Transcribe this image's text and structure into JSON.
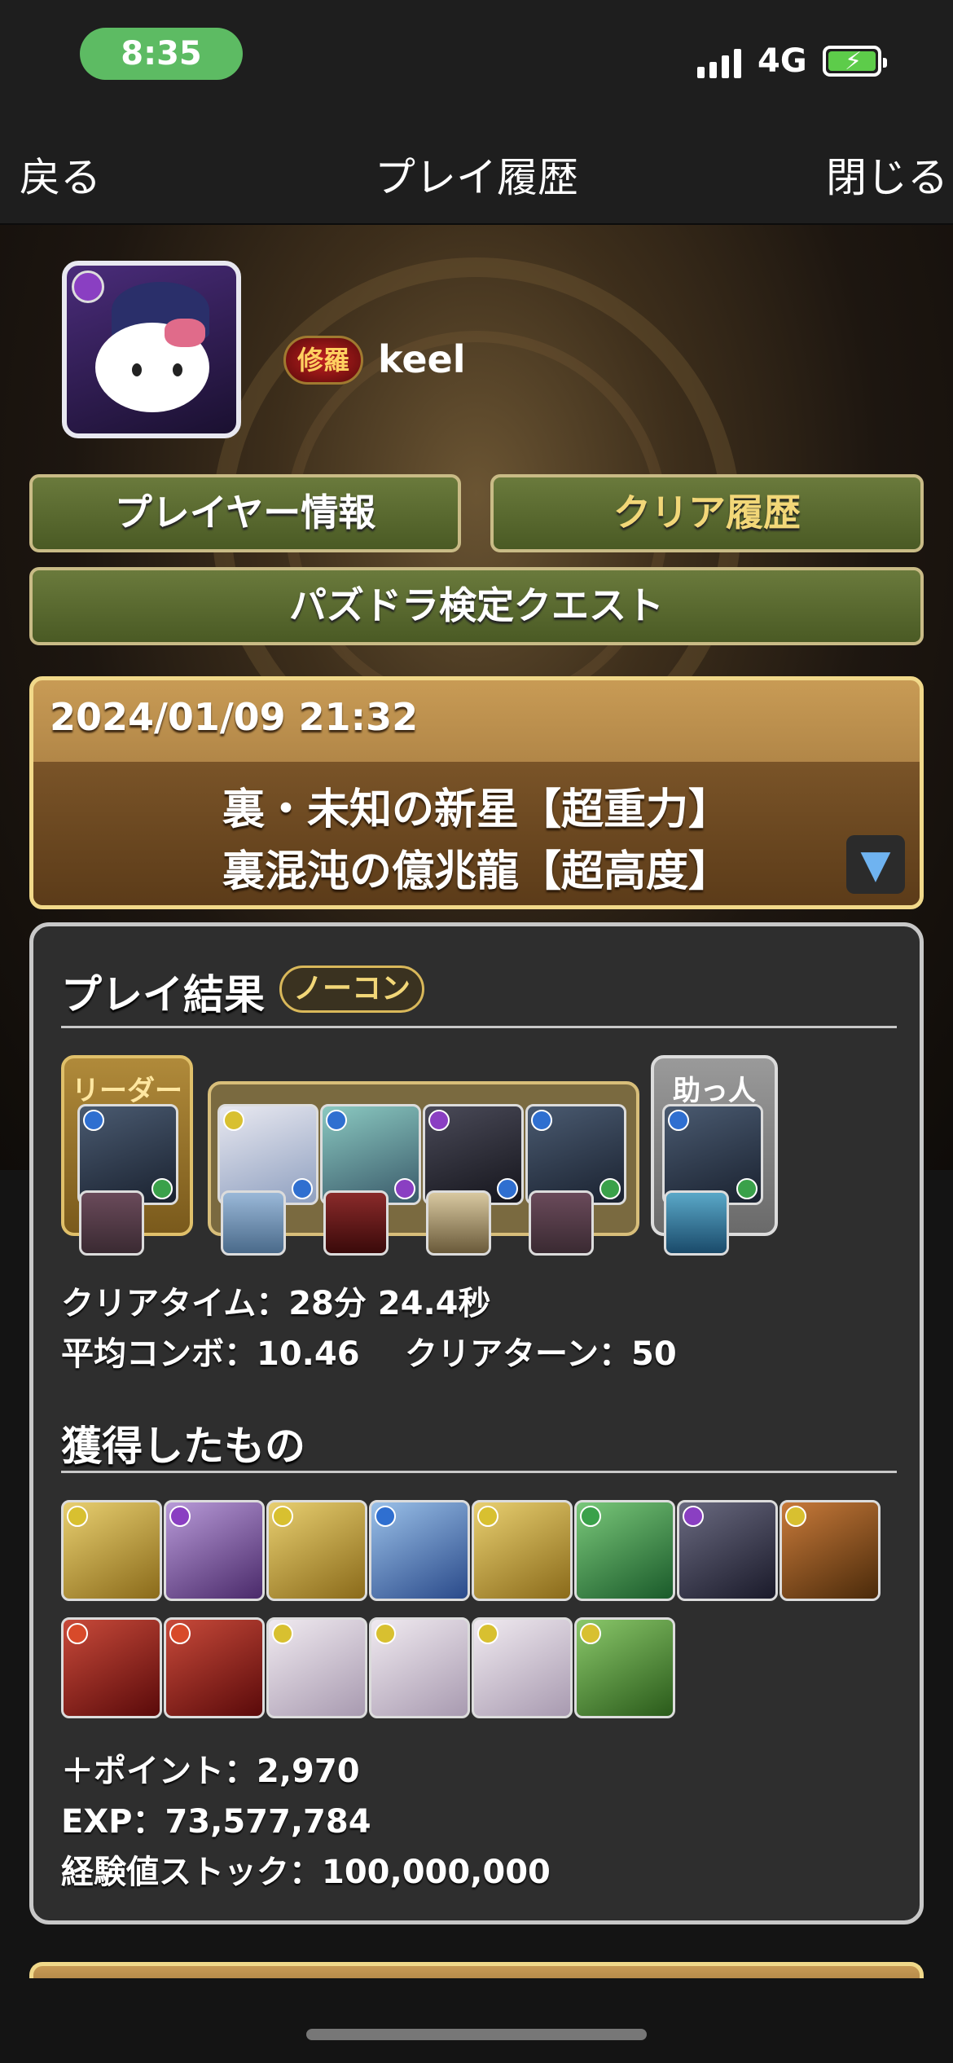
{
  "status_bar": {
    "time": "8:35",
    "network": "4G",
    "battery_icon": "battery-charging-icon"
  },
  "nav": {
    "back": "戻る",
    "title": "プレイ履歴",
    "close": "閉じる"
  },
  "profile": {
    "rank_badge": "修羅",
    "username": "keel"
  },
  "tabs": {
    "player_info": "プレイヤー情報",
    "clear_history": "クリア履歴",
    "quest": "パズドラ検定クエスト"
  },
  "history_entry": {
    "datetime": "2024/01/09 21:32",
    "dungeon": "裏・未知の新星【超重力】",
    "floor": "裏混沌の億兆龍【超高度】",
    "toggle_icon": "triangle-down-icon"
  },
  "result": {
    "title": "プレイ結果",
    "badge": "ノーコン",
    "leader_label": "リーダー",
    "helper_label": "助っ人",
    "clear_time": "クリアタイム：28分 24.4秒",
    "avg_combo": "平均コンボ：10.46",
    "clear_turns": "クリアターン：50"
  },
  "rewards": {
    "title": "獲得したもの",
    "points": "＋ポイント：2,970",
    "exp": "EXP：73,577,784",
    "exp_stock": "経験値ストック：100,000,000"
  },
  "colors": {
    "accent_gold": "#f1d98a",
    "button_green": "#5a6a30",
    "clear_history_text": "#f2d778"
  }
}
